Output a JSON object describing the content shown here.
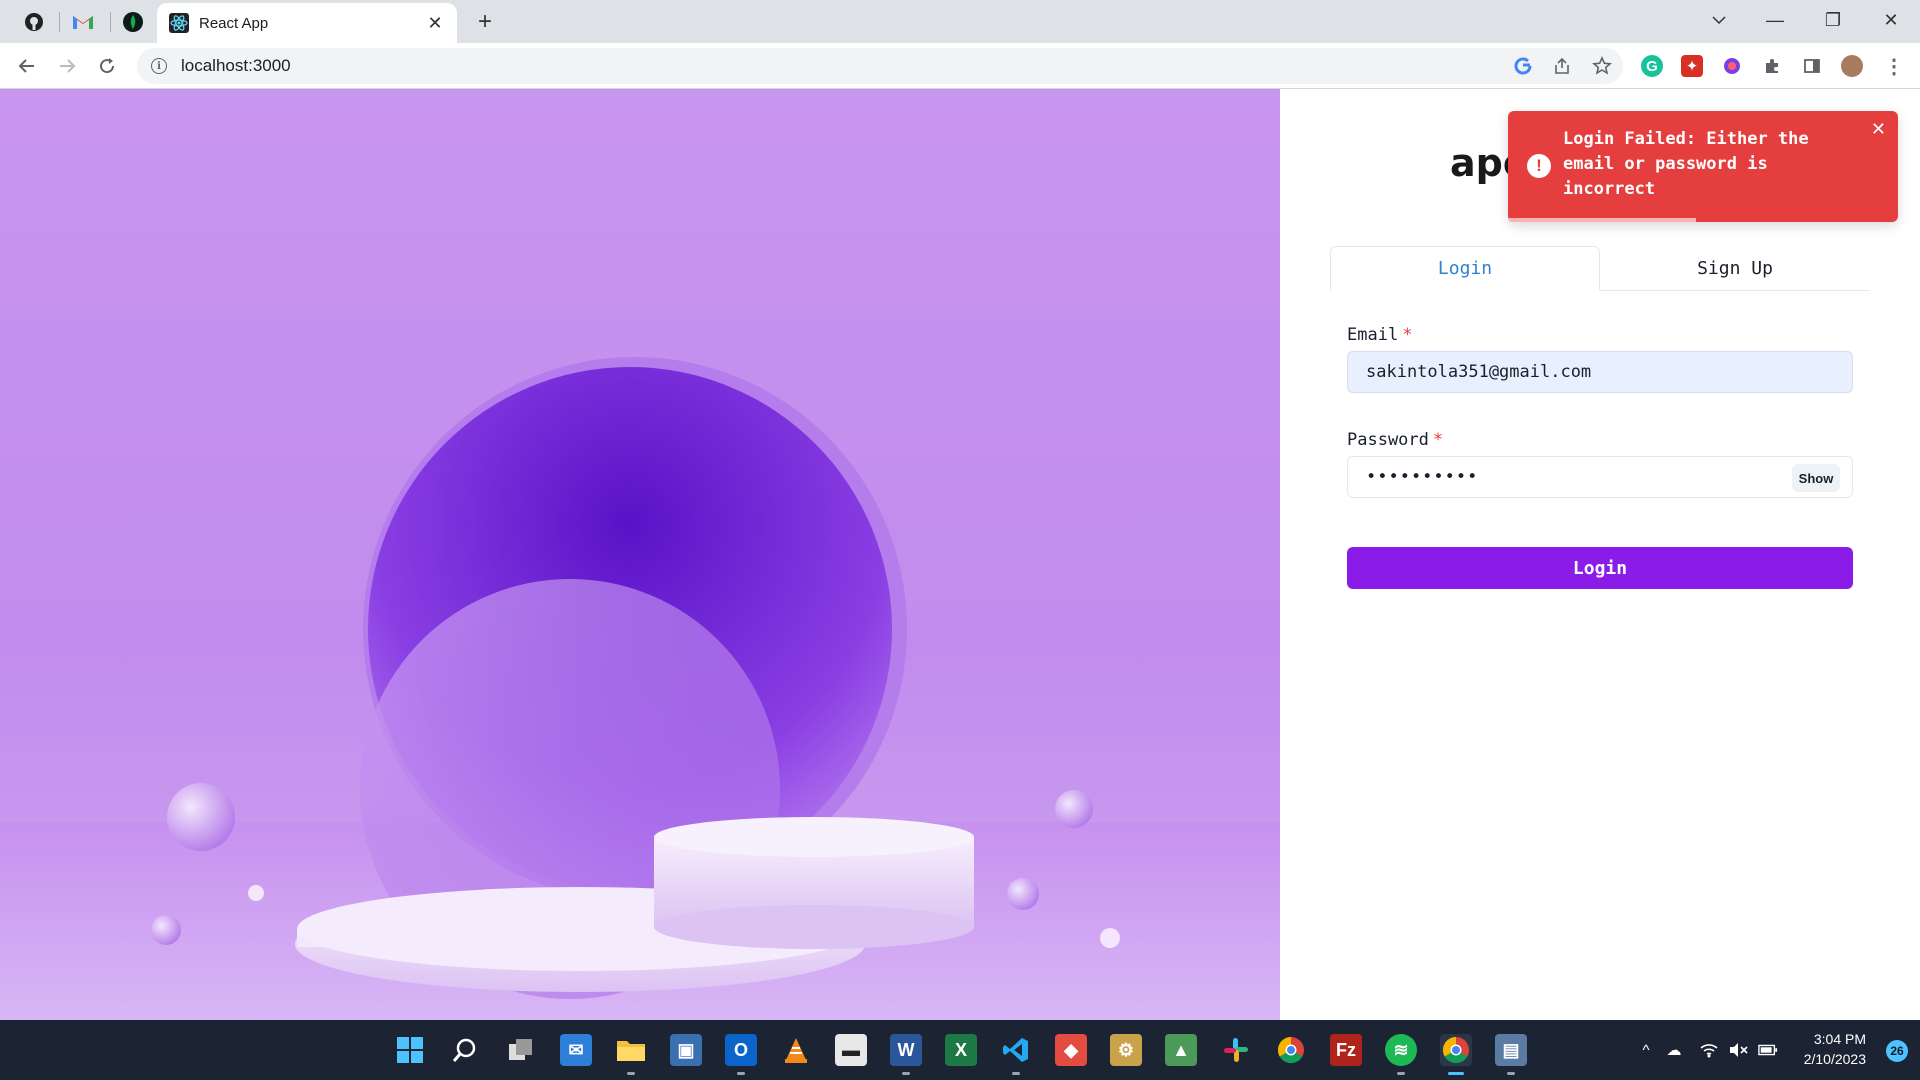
{
  "browser": {
    "tab_title": "React App",
    "tab_close": "✕",
    "new_tab": "+",
    "url": "localhost:3000",
    "window_controls": {
      "minimize": "—",
      "restore": "❐",
      "close": "✕"
    }
  },
  "page": {
    "brand": "ape",
    "tabs": [
      {
        "label": "Login",
        "active": true
      },
      {
        "label": "Sign Up",
        "active": false
      }
    ],
    "email": {
      "label": "Email",
      "required_mark": "*",
      "value": "sakintola351@gmail.com"
    },
    "password": {
      "label": "Password",
      "required_mark": "*",
      "masked_value": "••••••••••",
      "show_label": "Show"
    },
    "submit_label": "Login",
    "toast": {
      "message": "Login Failed: Either the email or password is incorrect",
      "close": "✕",
      "icon": "!"
    }
  },
  "taskbar": {
    "time": "3:04 PM",
    "date": "2/10/2023",
    "notifications": "26"
  },
  "colors": {
    "accent": "#8a1be8",
    "toast": "#e53e3e",
    "tab_active": "#3182ce",
    "hero": "#c18ced"
  }
}
